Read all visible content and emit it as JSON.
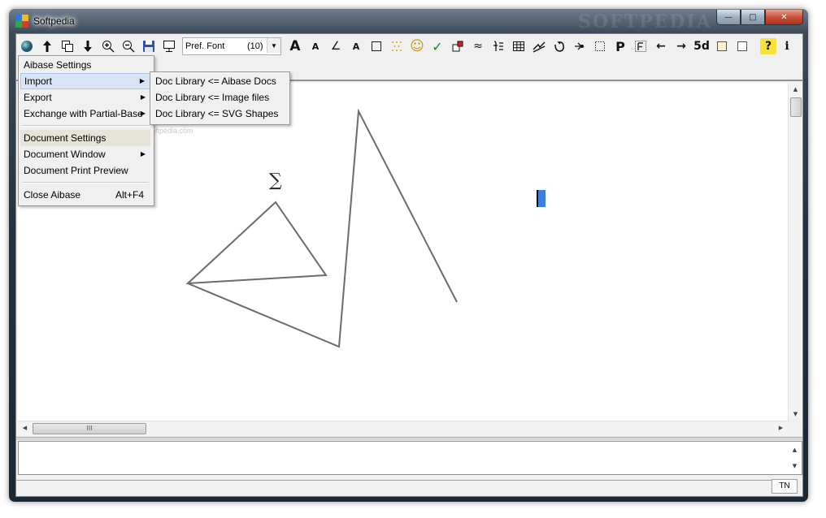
{
  "window": {
    "title": "Softpedia",
    "watermark": "SOFTPEDIA",
    "controls": {
      "minimize": "—",
      "maximize": "□",
      "close": "✕"
    }
  },
  "toolbar": {
    "icons": [
      "sphere-icon",
      "arrow-up-icon",
      "copy-icon",
      "arrow-down-icon",
      "zoom-in-icon",
      "zoom-out-icon",
      "save-icon",
      "monitor-icon"
    ],
    "font_name": "Pref. Font",
    "font_size": "(10)",
    "glyphs": {
      "font_bigger": "A",
      "font_smaller": "A",
      "angle_text": "∠",
      "text_a": "A",
      "smiley": "☺",
      "check": "✓",
      "wave": "≈",
      "paragraph": "P",
      "arrow_left": "←",
      "arrow_right": "→",
      "five_d": "5d",
      "help": "?",
      "info": "i"
    }
  },
  "menu": {
    "items": [
      {
        "label": "Aibase Settings"
      },
      {
        "label": "Import",
        "has_submenu": true
      },
      {
        "label": "Export",
        "has_submenu": true
      },
      {
        "label": "Exchange with Partial-Base",
        "has_submenu": true
      },
      {
        "label": "Document Settings"
      },
      {
        "label": "Document Window",
        "has_submenu": true
      },
      {
        "label": "Document Print Preview"
      },
      {
        "label": "Close Aibase",
        "shortcut": "Alt+F4"
      }
    ],
    "submenu_arrow": "▶"
  },
  "submenu": {
    "items": [
      {
        "label": "Doc Library <= Aibase Docs"
      },
      {
        "label": "Doc Library <= Image files"
      },
      {
        "label": "Doc Library <= SVG Shapes"
      }
    ]
  },
  "canvas": {
    "sigma": "∑",
    "softpedia_mark": "www.softpedia.com",
    "line_color": "#6b6b6b",
    "cursor_color": "#3b7fe0"
  },
  "scroll": {
    "h_thumb_grip": "III"
  },
  "status": {
    "mode": "TN"
  }
}
